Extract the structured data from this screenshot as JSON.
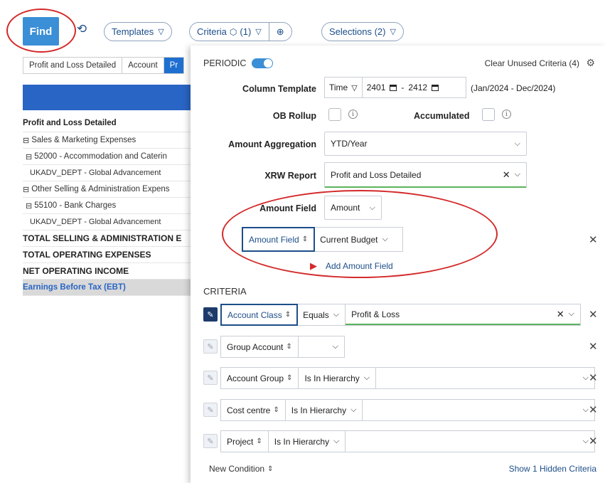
{
  "toolbar": {
    "find_label": "Find",
    "templates_label": "Templates",
    "criteria_label": "Criteria",
    "criteria_count": "(1)",
    "selections_label": "Selections (2)"
  },
  "report": {
    "tabs": [
      "Profit and Loss Detailed",
      "Account",
      "Pr"
    ],
    "header": "Profit and Loss Detailed",
    "rows": [
      {
        "text": "Sales & Marketing Expenses",
        "prefix": "⊟"
      },
      {
        "text": "52000 - Accommodation and Caterin",
        "prefix": "⊟"
      },
      {
        "text": "UKADV_DEPT - Global Advancement",
        "prefix": ""
      },
      {
        "text": "Other Selling & Administration Expens",
        "prefix": "⊟"
      },
      {
        "text": "55100 - Bank Charges",
        "prefix": "⊟"
      },
      {
        "text": "UKADV_DEPT - Global Advancement",
        "prefix": ""
      }
    ],
    "totals": [
      "TOTAL SELLING & ADMINISTRATION E",
      "TOTAL OPERATING EXPENSES",
      "NET OPERATING INCOME"
    ],
    "ebt": "Earnings Before Tax (EBT)"
  },
  "panel": {
    "periodic_label": "PERIODIC",
    "periodic_on": true,
    "clear_unused": "Clear Unused Criteria (4)",
    "column_template_label": "Column Template",
    "column_template_value": "Time",
    "range_start": "2401",
    "range_sep": "-",
    "range_end": "2412",
    "range_text": "(Jan/2024 - Dec/2024)",
    "ob_rollup_label": "OB Rollup",
    "accumulated_label": "Accumulated",
    "amount_aggregation_label": "Amount Aggregation",
    "amount_aggregation_value": "YTD/Year",
    "xrw_report_label": "XRW Report",
    "xrw_report_value": "Profit and Loss Detailed",
    "amount_field_label": "Amount Field",
    "amount_field_value": "Amount",
    "amount_field2_label": "Amount Field",
    "amount_field2_value": "Current Budget",
    "add_amount_field": "Add Amount Field"
  },
  "criteria": {
    "title": "CRITERIA",
    "rows": [
      {
        "field": "Account Class",
        "operator": "Equals",
        "value": "Profit & Loss",
        "active": true
      },
      {
        "field": "Group Account",
        "operator": "",
        "value": "",
        "active": false
      },
      {
        "field": "Account Group",
        "operator": "Is In Hierarchy",
        "value": "",
        "active": false
      },
      {
        "field": "Cost centre",
        "operator": "Is In Hierarchy",
        "value": "",
        "active": false
      },
      {
        "field": "Project",
        "operator": "Is In Hierarchy",
        "value": "",
        "active": false
      }
    ],
    "new_condition": "New Condition",
    "show_hidden": "Show 1 Hidden Criteria"
  },
  "colors": {
    "accent": "#3b8fd6",
    "navy": "#1d4e89",
    "highlight_red": "#d42a2a",
    "report_band": "#2965c4"
  }
}
